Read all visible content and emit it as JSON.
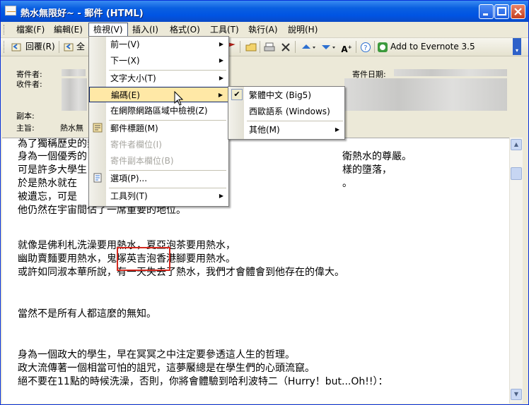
{
  "window": {
    "title": "熱水無限好~ - 郵件 (HTML)"
  },
  "menubar": [
    "檔案(F)",
    "編輯(E)",
    "檢視(V)",
    "插入(I)",
    "格式(O)",
    "工具(T)",
    "執行(A)",
    "說明(H)"
  ],
  "toolbar": {
    "reply": "回覆(R)",
    "reply_all": "全",
    "evernote": "Add to Evernote 3.5"
  },
  "header": {
    "from_label": "寄件者:",
    "to_label": "收件者:",
    "date_label": "寄件日期:",
    "cc_label": "副本:",
    "subject_label": "主旨:",
    "subject_value": "熱水無"
  },
  "view_menu": {
    "items": [
      {
        "label": "前一(V)",
        "submenu": true
      },
      {
        "label": "下一(X)",
        "submenu": true
      },
      {
        "label": "文字大小(T)",
        "submenu": true
      },
      {
        "label": "編碼(E)",
        "submenu": true
      },
      {
        "label": "在網際網路區域中檢視(Z)",
        "submenu": false
      },
      {
        "label": "郵件標題(M)",
        "submenu": false
      },
      {
        "label": "寄件者欄位(I)",
        "submenu": false
      },
      {
        "label": "寄件副本欄位(B)",
        "submenu": false
      },
      {
        "label": "選項(P)...",
        "submenu": false
      },
      {
        "label": "工具列(T)",
        "submenu": true
      }
    ]
  },
  "encoding_submenu": {
    "items": [
      {
        "label": "繁體中文 (Big5)",
        "checked": true
      },
      {
        "label": "西歐語系 (Windows)",
        "checked": false
      },
      {
        "label": "其他(M)",
        "submenu": true
      }
    ]
  },
  "body": {
    "lines": [
      "為了獨稱歷史的熱水",
      "身為一個優秀的",
      "可是許多大學生",
      "於是熱水就在",
      "被遺忘，可是",
      "他仍然在宇宙間佔了一席重要的地位。",
      "就像是佛利札洗澡要用熱水，夏亞泡茶要用熱水，",
      "幽助賣麵要用熱水，鬼塚英吉泡香港腳要用熱水。",
      "或許如同淑本華所說，有一天失去了熱水，我們才會體會到他存在的偉大。",
      "當然不是所有人都這麼的無知。",
      "身為一個政大的學生，早在冥冥之中注定要參透這人生的哲理。",
      "政大流傳著一個相當可怕的詛咒，這夢饜總是在學生們的心頭流竄。",
      "絕不要在11點的時候洗澡，否則，你將會體驗到哈利波特二（Hurry！but...Oh!!）："
    ],
    "right_fragments": [
      "衛熱水的尊嚴。",
      "樣的墮落，",
      "。"
    ]
  }
}
